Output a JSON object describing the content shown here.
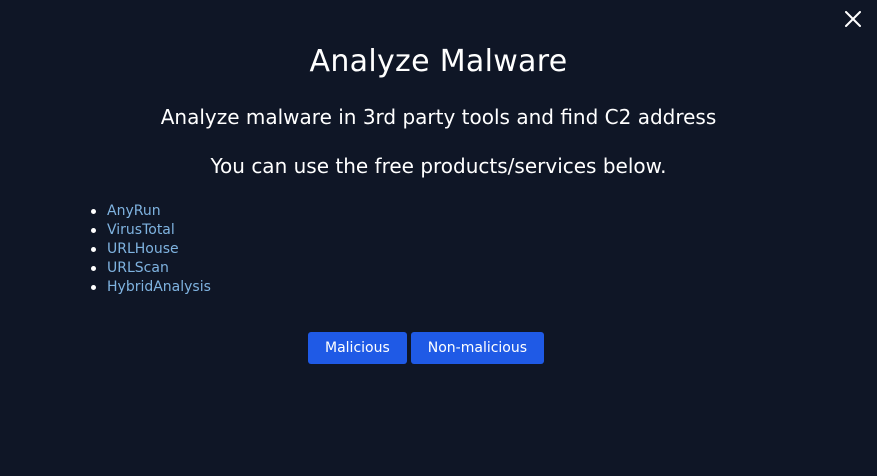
{
  "modal": {
    "title": "Analyze Malware",
    "subtitle": "Analyze malware in 3rd party tools and find C2 address",
    "hint": "You can use the free products/services below.",
    "close_icon": "close-icon"
  },
  "tools": [
    {
      "label": "AnyRun"
    },
    {
      "label": "VirusTotal"
    },
    {
      "label": "URLHouse"
    },
    {
      "label": "URLScan"
    },
    {
      "label": "HybridAnalysis"
    }
  ],
  "actions": {
    "malicious_label": "Malicious",
    "non_malicious_label": "Non-malicious"
  },
  "colors": {
    "background": "#0f1626",
    "link": "#7fb3e0",
    "button": "#1f5ae6",
    "text": "#ffffff"
  }
}
